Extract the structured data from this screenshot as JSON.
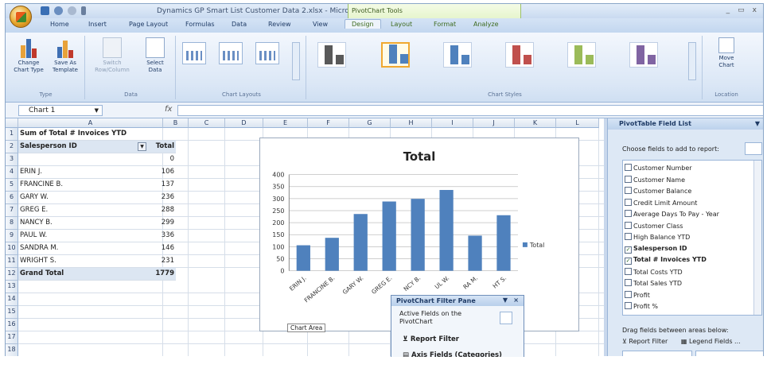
{
  "window": {
    "title": "Dynamics GP Smart List Customer Data 2.xlsx - Micro...",
    "context_tools": "PivotChart Tools",
    "controls": [
      "_",
      "▭",
      "x"
    ]
  },
  "tabs": [
    "Home",
    "Insert",
    "Page Layout",
    "Formulas",
    "Data",
    "Review",
    "View",
    "Design",
    "Layout",
    "Format",
    "Analyze"
  ],
  "active_tab": "Design",
  "ribbon": {
    "type_group": {
      "label": "Type",
      "change_chart_type": [
        "Change",
        "Chart Type"
      ],
      "save_as_template": [
        "Save As",
        "Template"
      ]
    },
    "data_group": {
      "label": "Data",
      "switch_row_col": [
        "Switch",
        "Row/Column"
      ],
      "select_data": [
        "Select",
        "Data"
      ]
    },
    "layouts_label": "Chart Layouts",
    "styles_label": "Chart Styles",
    "location_group": {
      "label": "Location",
      "move_chart": [
        "Move",
        "Chart"
      ]
    },
    "style_colors": [
      "#595959",
      "#4f81bd",
      "#4f81bd",
      "#c0504d",
      "#9bbb59",
      "#8064a2"
    ]
  },
  "formula_bar": {
    "name_box": "Chart 1",
    "fx": "fx",
    "value": ""
  },
  "columns": [
    "A",
    "B",
    "C",
    "D",
    "E",
    "F",
    "G",
    "H",
    "I",
    "J",
    "K",
    "L"
  ],
  "rows": [
    "1",
    "2",
    "3",
    "4",
    "5",
    "6",
    "7",
    "8",
    "9",
    "10",
    "11",
    "12",
    "13",
    "14",
    "15",
    "16",
    "17",
    "18"
  ],
  "sheet": {
    "title": "Sum of Total # Invoices YTD",
    "header_a": "Salesperson ID",
    "header_b": "Total",
    "data": [
      {
        "a": "",
        "b": "0"
      },
      {
        "a": "ERIN J.",
        "b": "106"
      },
      {
        "a": "FRANCINE B.",
        "b": "137"
      },
      {
        "a": "GARY W.",
        "b": "236"
      },
      {
        "a": "GREG E.",
        "b": "288"
      },
      {
        "a": "NANCY B.",
        "b": "299"
      },
      {
        "a": "PAUL W.",
        "b": "336"
      },
      {
        "a": "SANDRA M.",
        "b": "146"
      },
      {
        "a": "WRIGHT S.",
        "b": "231"
      }
    ],
    "grand_total_label": "Grand Total",
    "grand_total": "1779"
  },
  "chart_data": {
    "type": "bar",
    "title": "Total",
    "categories": [
      "ERIN J.",
      "FRANCINE B.",
      "GARY W.",
      "GREG E.",
      "NANCY B.",
      "PAUL W.",
      "SANDRA M.",
      "WRIGHT S."
    ],
    "category_labels_visible": [
      "ERIN J.",
      "FRANCINE B.",
      "GARY W.",
      "GREG E.",
      "NCY B.",
      "UL W.",
      "RA M.",
      "HT S."
    ],
    "series": [
      {
        "name": "Total",
        "values": [
          106,
          137,
          236,
          288,
          299,
          336,
          146,
          231
        ],
        "color": "#4f81bd"
      }
    ],
    "ylim": [
      0,
      400
    ],
    "yticks": [
      0,
      50,
      100,
      150,
      200,
      250,
      300,
      350,
      400
    ],
    "grid": true,
    "legend": "right"
  },
  "chart_area_tip": "Chart Area",
  "filter_pane": {
    "title": "PivotChart Filter Pane",
    "active_fields": "Active Fields on the PivotChart",
    "report_filter": "Report Filter",
    "axis_fields": "Axis Fields (Categories)"
  },
  "field_list": {
    "title": "PivotTable Field List",
    "choose": "Choose fields to add to report:",
    "fields": [
      {
        "name": "Customer Number",
        "checked": false
      },
      {
        "name": "Customer Name",
        "checked": false
      },
      {
        "name": "Customer Balance",
        "checked": false
      },
      {
        "name": "Credit Limit Amount",
        "checked": false
      },
      {
        "name": "Average Days To Pay - Year",
        "checked": false
      },
      {
        "name": "Customer Class",
        "checked": false
      },
      {
        "name": "High Balance YTD",
        "checked": false
      },
      {
        "name": "Salesperson ID",
        "checked": true
      },
      {
        "name": "Total # Invoices YTD",
        "checked": true
      },
      {
        "name": "Total Costs YTD",
        "checked": false
      },
      {
        "name": "Total Sales YTD",
        "checked": false
      },
      {
        "name": "Profit",
        "checked": false
      },
      {
        "name": "Profit %",
        "checked": false
      }
    ],
    "drag_label": "Drag fields between areas below:",
    "report_filter": "Report Filter",
    "legend_fields": "Legend Fields ..."
  }
}
